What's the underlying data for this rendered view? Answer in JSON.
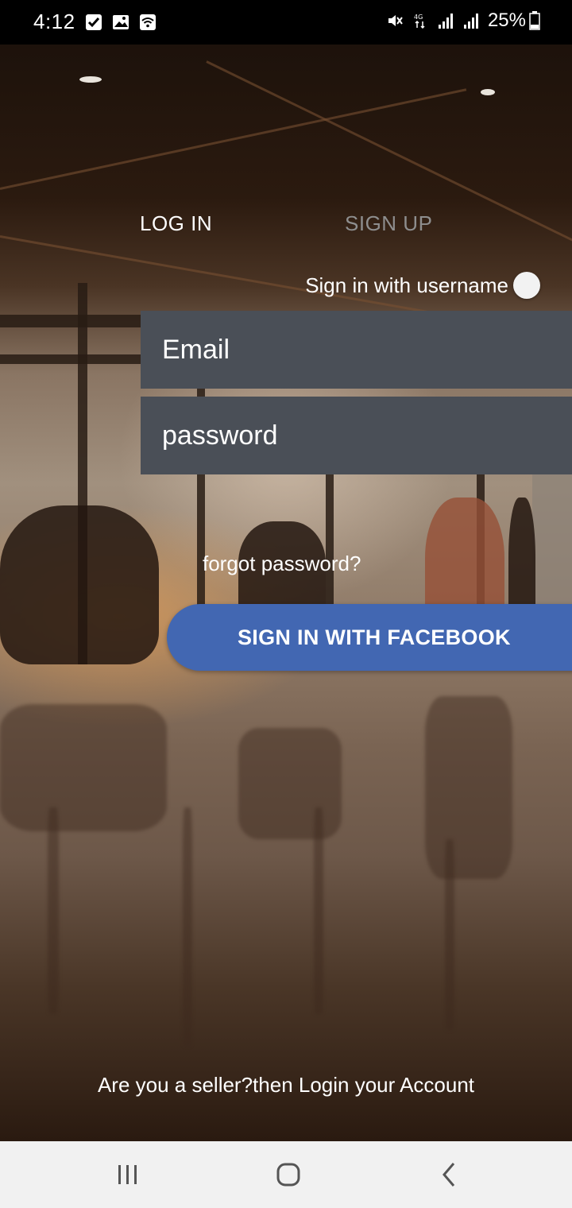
{
  "status_bar": {
    "time": "4:12",
    "battery": "25%",
    "icons": [
      "check-icon",
      "image-icon",
      "wifi-icon",
      "mute-icon",
      "4g-icon",
      "signal-icon",
      "signal-icon",
      "battery-icon"
    ]
  },
  "tabs": {
    "login_label": "LOG IN",
    "signup_label": "SIGN UP",
    "active": "login"
  },
  "toggle": {
    "label": "Sign in with username",
    "on": false
  },
  "form": {
    "email_placeholder": "Email",
    "password_placeholder": "password",
    "forgot_label": "forgot password?"
  },
  "facebook_button": {
    "label": "SIGN IN WITH FACEBOOK",
    "color": "#4267b2"
  },
  "seller": {
    "label": "Are you a seller?then Login your Account"
  },
  "nav_bar": {
    "icons": [
      "recents-icon",
      "home-icon",
      "back-icon"
    ]
  }
}
